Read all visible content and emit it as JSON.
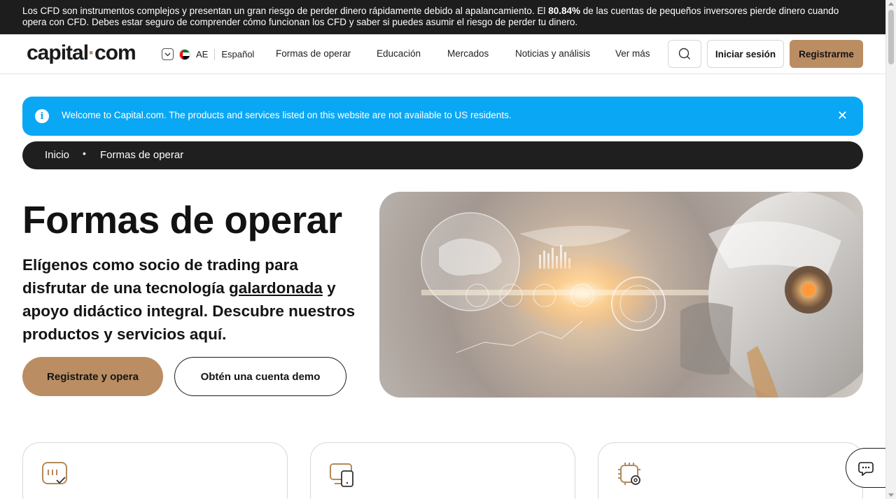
{
  "risk_banner": {
    "text_before": "Los CFD son instrumentos complejos y presentan un gran riesgo de perder dinero rápidamente debido al apalancamiento. El ",
    "percent": "80.84%",
    "text_after": " de las cuentas de pequeños inversores pierde dinero cuando opera con CFD. Debes estar seguro de comprender cómo funcionan los CFD y saber si puedes asumir el riesgo de perder tu dinero."
  },
  "header": {
    "logo_left": "capital",
    "logo_dot": "·",
    "logo_right": "com",
    "region_code": "AE",
    "language": "Español",
    "nav": [
      "Formas de operar",
      "Educación",
      "Mercados",
      "Noticias y análisis",
      "Ver más"
    ],
    "login_label": "Iniciar sesión",
    "signup_label": "Registrarme"
  },
  "info_banner": {
    "icon": "info-icon",
    "message": "Welcome to Capital.com. The products and services listed on this website are not available to US residents.",
    "close": "✕"
  },
  "breadcrumb": {
    "items": [
      "Inicio",
      "Formas de operar"
    ],
    "separator": "•"
  },
  "hero": {
    "title": "Formas de operar",
    "subtitle_before": "Elígenos como socio de trading para disfrutar de una tecnología ",
    "subtitle_link": "galardonada",
    "subtitle_after": " y apoyo didáctico integral. Descubre nuestros productos y servicios aquí.",
    "cta_primary": "Registrate y opera",
    "cta_secondary": "Obtén una cuenta demo"
  },
  "cards": [
    {
      "icon": "chat-check-icon"
    },
    {
      "icon": "devices-icon"
    },
    {
      "icon": "chip-gear-icon"
    }
  ],
  "colors": {
    "accent": "#bb8d63",
    "info_blue": "#0aa7f5",
    "dark": "#1f1f1f"
  }
}
